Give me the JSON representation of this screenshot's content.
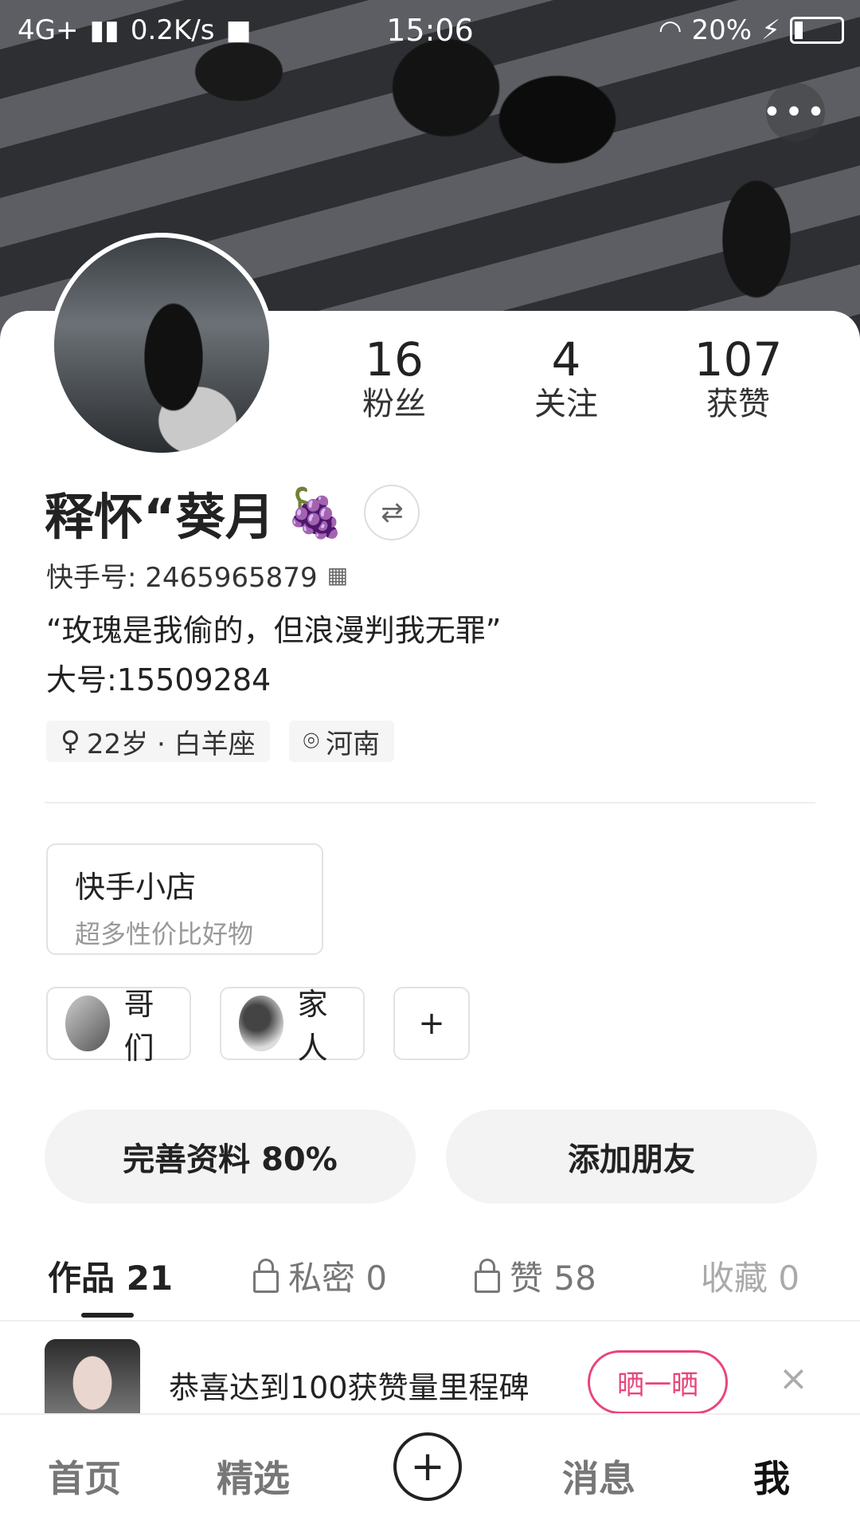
{
  "status_bar": {
    "network": "4G+",
    "speed": "0.2K/s",
    "time": "15:06",
    "battery": "20%"
  },
  "profile": {
    "stats": [
      {
        "value": "16",
        "label": "粉丝"
      },
      {
        "value": "4",
        "label": "关注"
      },
      {
        "value": "107",
        "label": "获赞"
      }
    ],
    "name": "释怀“葵月",
    "emoji": "🍇",
    "kuaishou_id": "快手号: 2465965879",
    "bio_line1": "“玫瑰是我偷的，但浪漫判我无罪”",
    "bio_line2": "大号:15509284",
    "tags": [
      {
        "icon": "gender-icon",
        "text": "22岁 · 白羊座"
      },
      {
        "icon": "location-icon",
        "text": "河南"
      }
    ]
  },
  "shop": {
    "title": "快手小店",
    "subtitle": "超多性价比好物"
  },
  "groups": [
    {
      "label": "哥们"
    },
    {
      "label": "家人"
    },
    {
      "label": "+"
    }
  ],
  "actions": {
    "complete_profile": "完善资料 80%",
    "add_friend": "添加朋友"
  },
  "tabs": [
    {
      "label": "作品 21"
    },
    {
      "label": "私密 0"
    },
    {
      "label": "赞 58"
    },
    {
      "label": "收藏 0"
    }
  ],
  "banner": {
    "text": "恭喜达到100获赞量里程碑",
    "button": "晒一晒",
    "close": "×"
  },
  "bottom_nav": [
    {
      "label": "首页"
    },
    {
      "label": "精选"
    },
    {
      "label": "+"
    },
    {
      "label": "消息"
    },
    {
      "label": "我"
    }
  ]
}
